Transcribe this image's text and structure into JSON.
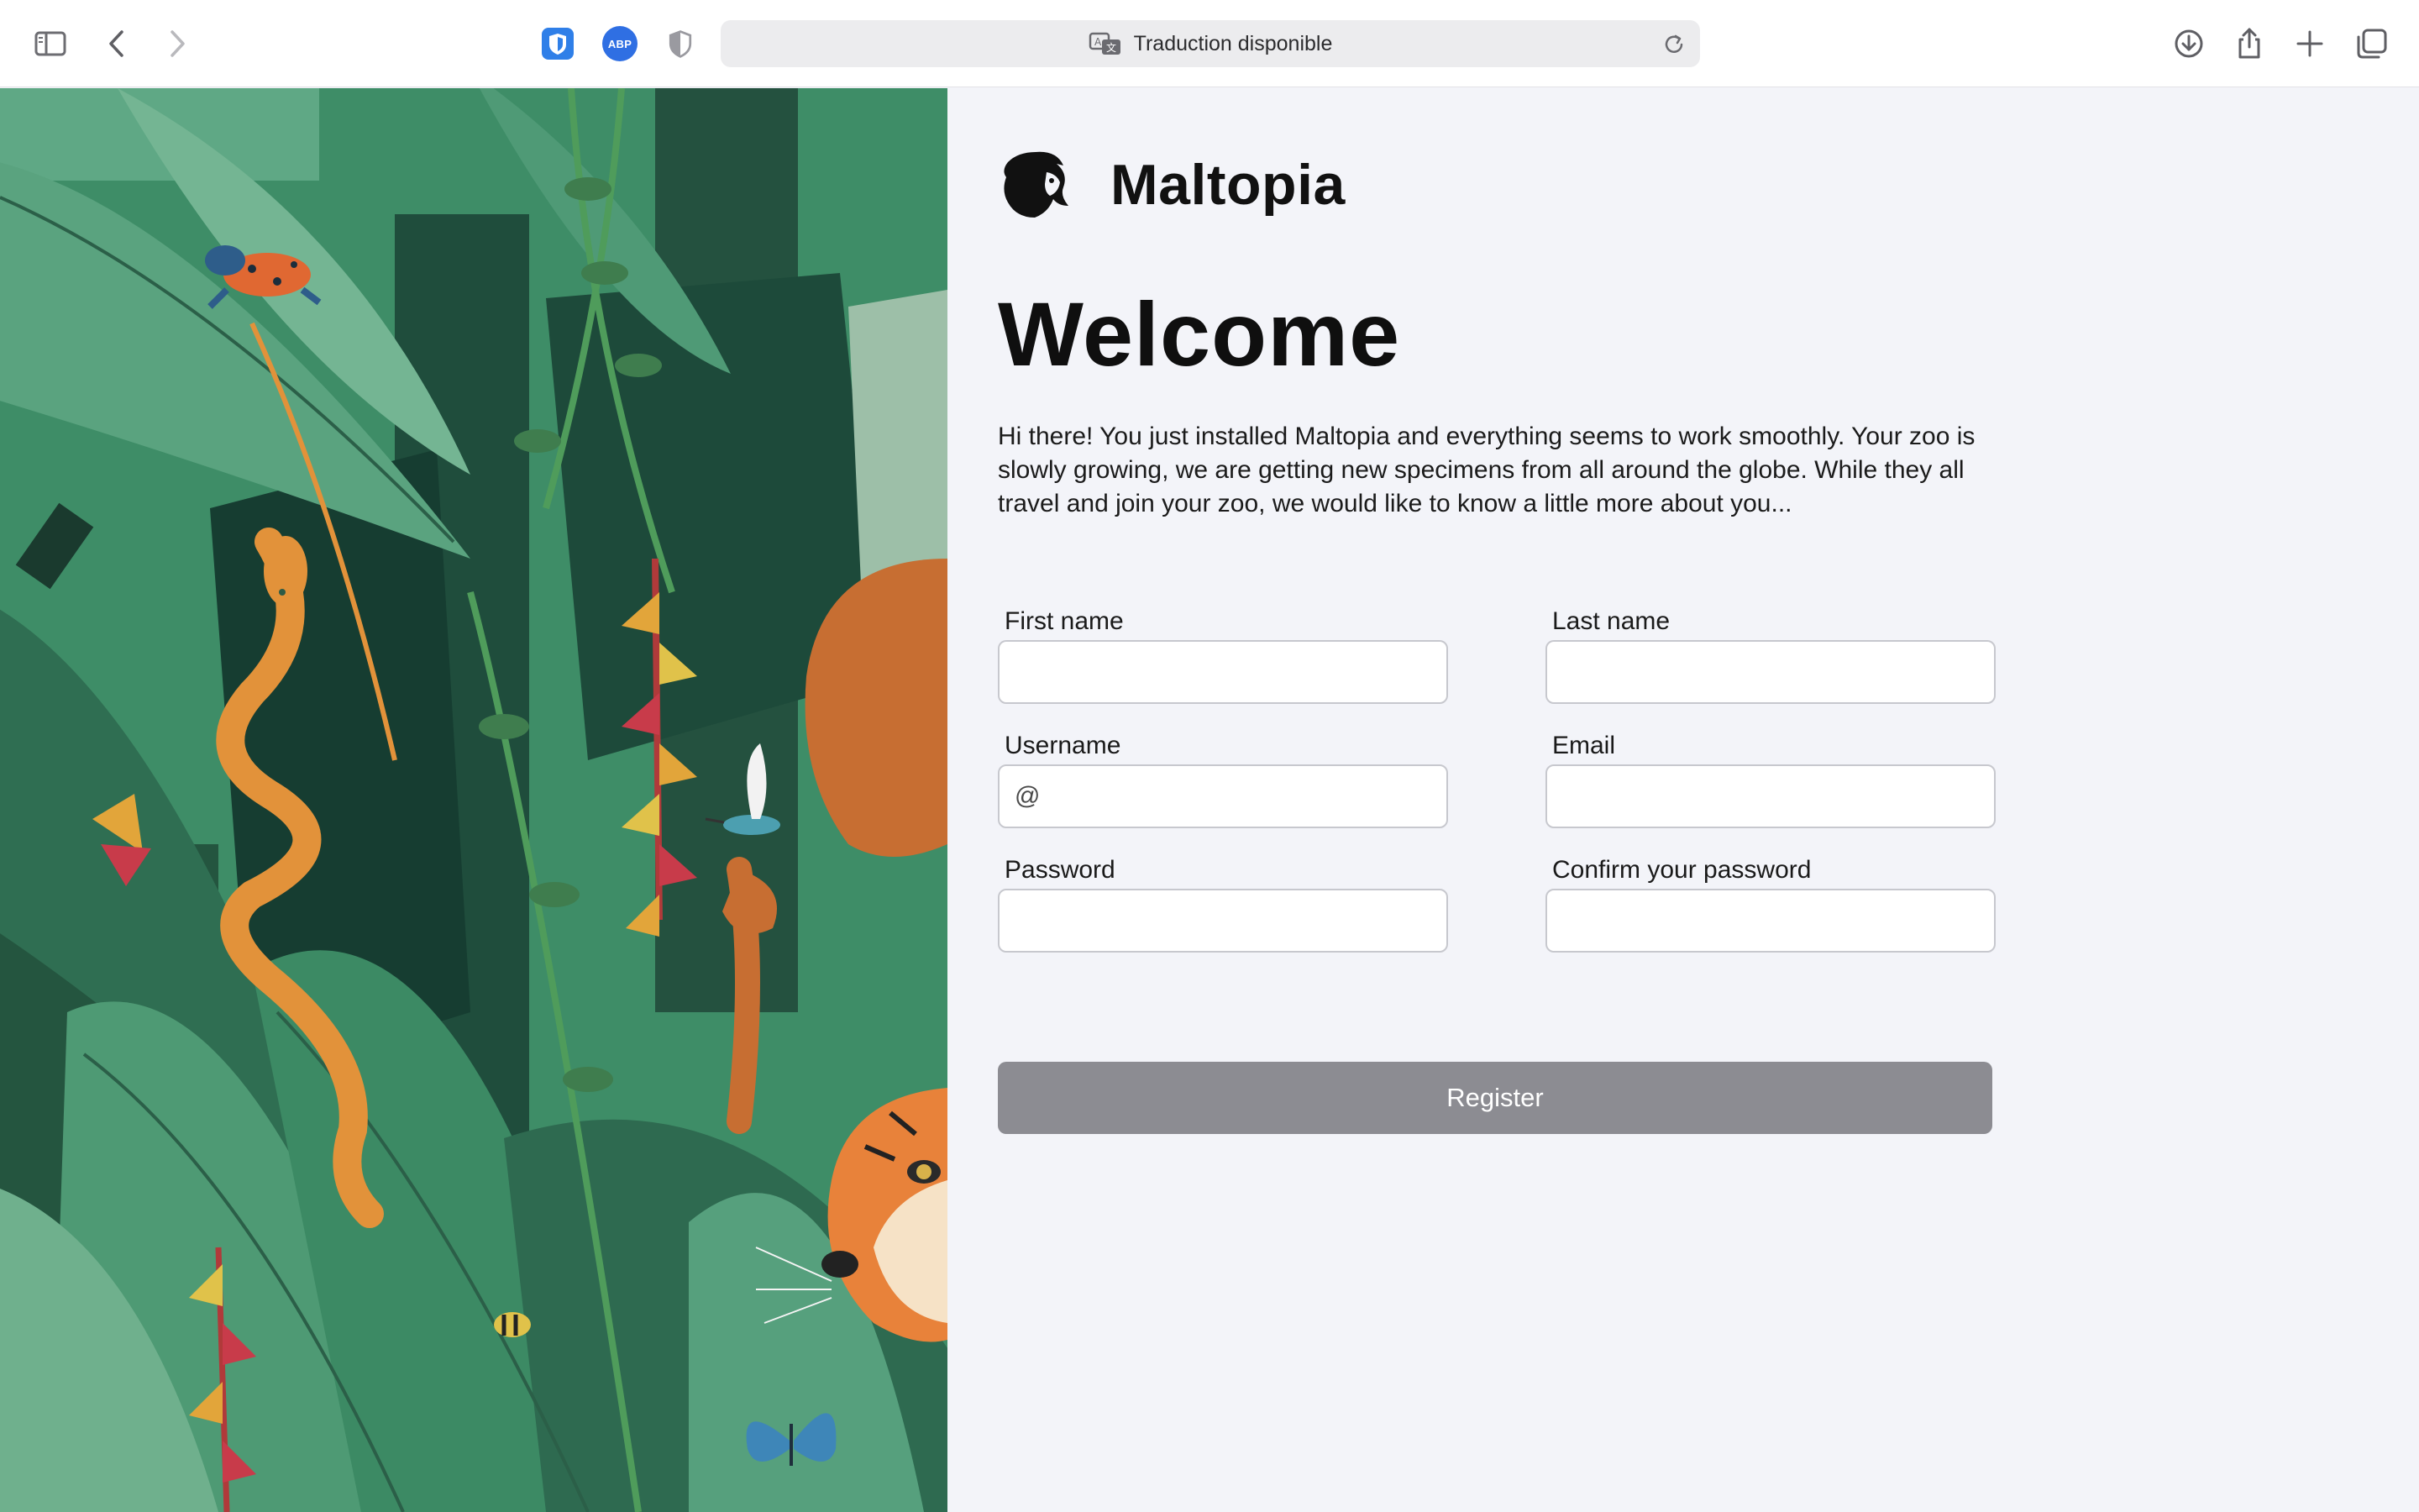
{
  "browser": {
    "address_text": "Traduction disponible",
    "extension_abp_label": "ABP",
    "icons": {
      "sidebar": "sidebar-icon",
      "back": "chevron-left-icon",
      "forward": "chevron-right-icon",
      "password_manager": "bitwarden-shield-icon",
      "adblock": "abp-icon",
      "privacy": "half-shield-icon",
      "translate": "translate-icon",
      "reload": "reload-icon",
      "downloads": "download-icon",
      "share": "share-icon",
      "new_tab": "plus-icon",
      "tabs_overview": "tabs-icon"
    }
  },
  "app": {
    "brand_name": "Maltopia",
    "logo_icon": "lion-head-icon",
    "title": "Welcome",
    "intro": "Hi there! You just installed Maltopia and everything seems to work smoothly. Your zoo is slowly growing, we are getting new specimens from all around the globe. While they all travel and join your zoo, we would like to know a little more about you...",
    "form": {
      "first_name_label": "First name",
      "first_name_value": "",
      "last_name_label": "Last name",
      "last_name_value": "",
      "username_label": "Username",
      "username_prefix": "@",
      "email_label": "Email",
      "email_value": "",
      "password_label": "Password",
      "password_value": "",
      "confirm_password_label": "Confirm your password",
      "confirm_password_value": "",
      "register_label": "Register"
    }
  },
  "colors": {
    "panel_bg": "#f3f4f9",
    "register_button": "#8c8c92",
    "jungle_base": "#3d8f68"
  }
}
